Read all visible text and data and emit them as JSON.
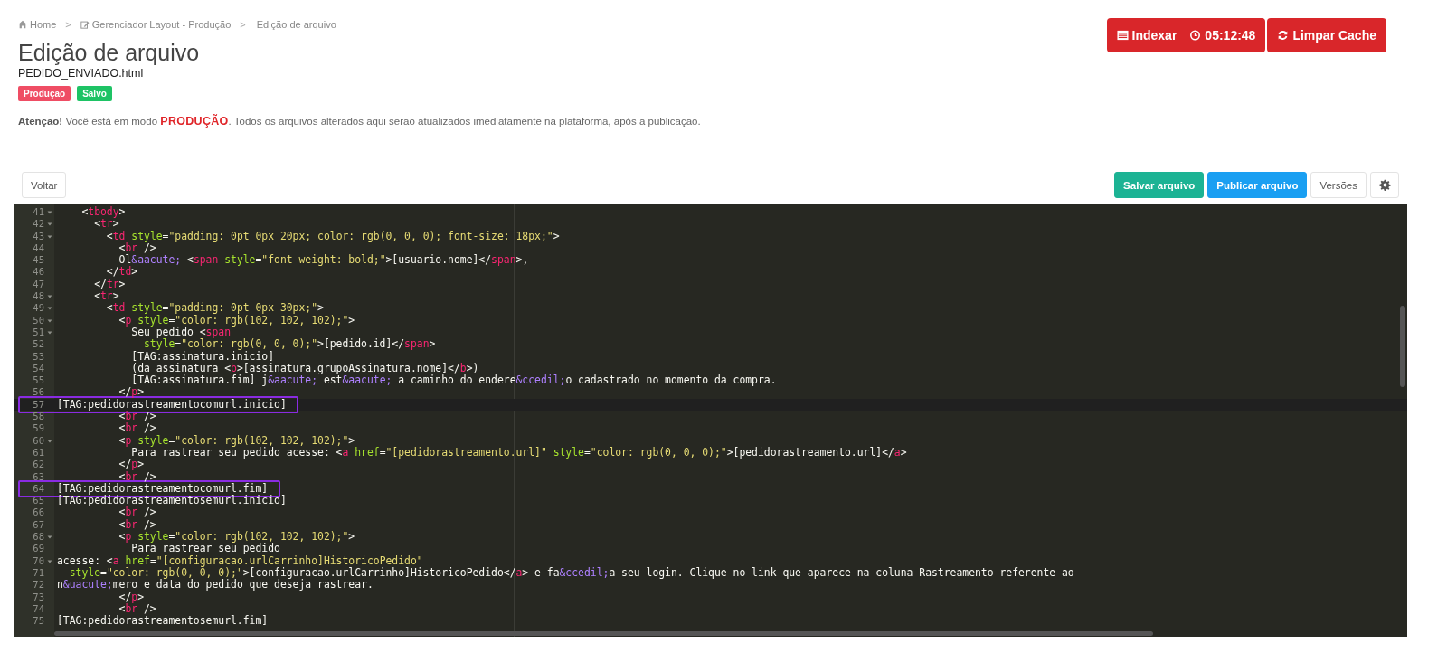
{
  "breadcrumb": [
    {
      "kind": "home",
      "label": "Home"
    },
    {
      "kind": "edit",
      "separator": ">",
      "label": "Gerenciador Layout - Produção"
    },
    {
      "kind": "text",
      "separator": ">",
      "label": "Edição de arquivo"
    }
  ],
  "title": "Edição de arquivo",
  "filename": "PEDIDO_ENVIADO.html",
  "badges": [
    {
      "label": "Produção",
      "color": "#ef4d64"
    },
    {
      "label": "Salvo",
      "color": "#1ec365"
    }
  ],
  "notice": "**Atenção!** Você está em modo **PRODUÇÃO**. Todos os arquivos alterados aqui serão atualizados imediatamente na plataforma, após a publicação.",
  "header_actions": {
    "index_label": "Indexar",
    "timer": "05:12:48",
    "cache_label": "Limpar Cache"
  },
  "back_button": "Voltar",
  "toolbar": [
    {
      "kind": "green",
      "label": "Salvar arquivo"
    },
    {
      "kind": "blue",
      "label": "Publicar arquivo"
    },
    {
      "kind": "plain",
      "label": "Versões"
    },
    {
      "kind": "settings"
    }
  ],
  "editor": {
    "lines": [
      {
        "number": "41",
        "foldable": true,
        "active": false,
        "highlighted": false,
        "tokens": [
          {
            "kind": "punct",
            "text": "    <"
          },
          {
            "kind": "tag",
            "text": "tbody"
          },
          {
            "kind": "punct",
            "text": ">"
          }
        ]
      },
      {
        "number": "42",
        "foldable": true,
        "active": false,
        "highlighted": false,
        "tokens": [
          {
            "kind": "punct",
            "text": "      <"
          },
          {
            "kind": "tag",
            "text": "tr"
          },
          {
            "kind": "punct",
            "text": ">"
          }
        ]
      },
      {
        "number": "43",
        "foldable": true,
        "active": false,
        "highlighted": false,
        "tokens": [
          {
            "kind": "punct",
            "text": "        <"
          },
          {
            "kind": "tag",
            "text": "td"
          },
          {
            "kind": "attr",
            "text": " style"
          },
          {
            "kind": "punct",
            "text": "="
          },
          {
            "kind": "string",
            "text": "\"padding: 0pt 0px 20px; color: rgb(0, 0, 0); font-size: 18px;\""
          },
          {
            "kind": "punct",
            "text": ">"
          }
        ]
      },
      {
        "number": "44",
        "foldable": false,
        "active": false,
        "highlighted": false,
        "tokens": [
          {
            "kind": "punct",
            "text": "          <"
          },
          {
            "kind": "tag",
            "text": "br"
          },
          {
            "kind": "punct",
            "text": " />"
          }
        ]
      },
      {
        "number": "45",
        "foldable": false,
        "active": false,
        "highlighted": false,
        "tokens": [
          {
            "kind": "punct",
            "text": "          Ol"
          },
          {
            "kind": "entity",
            "text": "&aacute;"
          },
          {
            "kind": "punct",
            "text": " <"
          },
          {
            "kind": "tag",
            "text": "span"
          },
          {
            "kind": "attr",
            "text": " style"
          },
          {
            "kind": "punct",
            "text": "="
          },
          {
            "kind": "string",
            "text": "\"font-weight: bold;\""
          },
          {
            "kind": "punct",
            "text": ">[usuario.nome]</"
          },
          {
            "kind": "tag",
            "text": "span"
          },
          {
            "kind": "punct",
            "text": ">,"
          }
        ]
      },
      {
        "number": "46",
        "foldable": false,
        "active": false,
        "highlighted": false,
        "tokens": [
          {
            "kind": "punct",
            "text": "        </"
          },
          {
            "kind": "tag",
            "text": "td"
          },
          {
            "kind": "punct",
            "text": ">"
          }
        ]
      },
      {
        "number": "47",
        "foldable": false,
        "active": false,
        "highlighted": false,
        "tokens": [
          {
            "kind": "punct",
            "text": "      </"
          },
          {
            "kind": "tag",
            "text": "tr"
          },
          {
            "kind": "punct",
            "text": ">"
          }
        ]
      },
      {
        "number": "48",
        "foldable": true,
        "active": false,
        "highlighted": false,
        "tokens": [
          {
            "kind": "punct",
            "text": "      <"
          },
          {
            "kind": "tag",
            "text": "tr"
          },
          {
            "kind": "punct",
            "text": ">"
          }
        ]
      },
      {
        "number": "49",
        "foldable": true,
        "active": false,
        "highlighted": false,
        "tokens": [
          {
            "kind": "punct",
            "text": "        <"
          },
          {
            "kind": "tag",
            "text": "td"
          },
          {
            "kind": "attr",
            "text": " style"
          },
          {
            "kind": "punct",
            "text": "="
          },
          {
            "kind": "string",
            "text": "\"padding: 0pt 0px 30px;\""
          },
          {
            "kind": "punct",
            "text": ">"
          }
        ]
      },
      {
        "number": "50",
        "foldable": true,
        "active": false,
        "highlighted": false,
        "tokens": [
          {
            "kind": "punct",
            "text": "          <"
          },
          {
            "kind": "tag",
            "text": "p"
          },
          {
            "kind": "attr",
            "text": " style"
          },
          {
            "kind": "punct",
            "text": "="
          },
          {
            "kind": "string",
            "text": "\"color: rgb(102, 102, 102);\""
          },
          {
            "kind": "punct",
            "text": ">"
          }
        ]
      },
      {
        "number": "51",
        "foldable": true,
        "active": false,
        "highlighted": false,
        "tokens": [
          {
            "kind": "punct",
            "text": "            Seu pedido <"
          },
          {
            "kind": "tag",
            "text": "span"
          }
        ]
      },
      {
        "number": "52",
        "foldable": false,
        "active": false,
        "highlighted": false,
        "tokens": [
          {
            "kind": "attr",
            "text": "              style"
          },
          {
            "kind": "punct",
            "text": "="
          },
          {
            "kind": "string",
            "text": "\"color: rgb(0, 0, 0);\""
          },
          {
            "kind": "punct",
            "text": ">[pedido.id]</"
          },
          {
            "kind": "tag",
            "text": "span"
          },
          {
            "kind": "punct",
            "text": ">"
          }
        ]
      },
      {
        "number": "53",
        "foldable": false,
        "active": false,
        "highlighted": false,
        "tokens": [
          {
            "kind": "punct",
            "text": "            [TAG:assinatura.inicio]"
          }
        ]
      },
      {
        "number": "54",
        "foldable": false,
        "active": false,
        "highlighted": false,
        "tokens": [
          {
            "kind": "punct",
            "text": "            (da assinatura <"
          },
          {
            "kind": "tag",
            "text": "b"
          },
          {
            "kind": "punct",
            "text": ">[assinatura.grupoAssinatura.nome]</"
          },
          {
            "kind": "tag",
            "text": "b"
          },
          {
            "kind": "punct",
            "text": ">)"
          }
        ]
      },
      {
        "number": "55",
        "foldable": false,
        "active": false,
        "highlighted": false,
        "tokens": [
          {
            "kind": "punct",
            "text": "            [TAG:assinatura.fim] j"
          },
          {
            "kind": "entity",
            "text": "&aacute;"
          },
          {
            "kind": "punct",
            "text": " est"
          },
          {
            "kind": "entity",
            "text": "&aacute;"
          },
          {
            "kind": "punct",
            "text": " a caminho do endere"
          },
          {
            "kind": "entity",
            "text": "&ccedil;"
          },
          {
            "kind": "punct",
            "text": "o cadastrado no momento da compra."
          }
        ]
      },
      {
        "number": "56",
        "foldable": false,
        "active": false,
        "highlighted": false,
        "tokens": [
          {
            "kind": "punct",
            "text": "          </"
          },
          {
            "kind": "tag",
            "text": "p"
          },
          {
            "kind": "punct",
            "text": ">"
          }
        ]
      },
      {
        "number": "57",
        "foldable": false,
        "active": true,
        "highlighted": true,
        "tokens": [
          {
            "kind": "punct",
            "text": "[TAG:pedidorastreamentocomurl.inicio]"
          }
        ]
      },
      {
        "number": "58",
        "foldable": false,
        "active": false,
        "highlighted": false,
        "tokens": [
          {
            "kind": "punct",
            "text": "          <"
          },
          {
            "kind": "tag",
            "text": "br"
          },
          {
            "kind": "punct",
            "text": " />"
          }
        ]
      },
      {
        "number": "59",
        "foldable": false,
        "active": false,
        "highlighted": false,
        "tokens": [
          {
            "kind": "punct",
            "text": "          <"
          },
          {
            "kind": "tag",
            "text": "br"
          },
          {
            "kind": "punct",
            "text": " />"
          }
        ]
      },
      {
        "number": "60",
        "foldable": true,
        "active": false,
        "highlighted": false,
        "tokens": [
          {
            "kind": "punct",
            "text": "          <"
          },
          {
            "kind": "tag",
            "text": "p"
          },
          {
            "kind": "attr",
            "text": " style"
          },
          {
            "kind": "punct",
            "text": "="
          },
          {
            "kind": "string",
            "text": "\"color: rgb(102, 102, 102);\""
          },
          {
            "kind": "punct",
            "text": ">"
          }
        ]
      },
      {
        "number": "61",
        "foldable": false,
        "active": false,
        "highlighted": false,
        "tokens": [
          {
            "kind": "punct",
            "text": "            Para rastrear seu pedido acesse: <"
          },
          {
            "kind": "tag",
            "text": "a"
          },
          {
            "kind": "attr",
            "text": " href"
          },
          {
            "kind": "punct",
            "text": "="
          },
          {
            "kind": "string",
            "text": "\"[pedidorastreamento.url]\""
          },
          {
            "kind": "attr",
            "text": " style"
          },
          {
            "kind": "punct",
            "text": "="
          },
          {
            "kind": "string",
            "text": "\"color: rgb(0, 0, 0);\""
          },
          {
            "kind": "punct",
            "text": ">[pedidorastreamento.url]</"
          },
          {
            "kind": "tag",
            "text": "a"
          },
          {
            "kind": "punct",
            "text": ">"
          }
        ]
      },
      {
        "number": "62",
        "foldable": false,
        "active": false,
        "highlighted": false,
        "tokens": [
          {
            "kind": "punct",
            "text": "          </"
          },
          {
            "kind": "tag",
            "text": "p"
          },
          {
            "kind": "punct",
            "text": ">"
          }
        ]
      },
      {
        "number": "63",
        "foldable": false,
        "active": false,
        "highlighted": false,
        "tokens": [
          {
            "kind": "punct",
            "text": "          <"
          },
          {
            "kind": "tag",
            "text": "br"
          },
          {
            "kind": "punct",
            "text": " />"
          }
        ]
      },
      {
        "number": "64",
        "foldable": false,
        "active": false,
        "highlighted": true,
        "tokens": [
          {
            "kind": "punct",
            "text": "[TAG:pedidorastreamentocomurl.fim]"
          }
        ]
      },
      {
        "number": "65",
        "foldable": false,
        "active": false,
        "highlighted": false,
        "tokens": [
          {
            "kind": "punct",
            "text": "[TAG:pedidorastreamentosemurl.inicio]"
          }
        ]
      },
      {
        "number": "66",
        "foldable": false,
        "active": false,
        "highlighted": false,
        "tokens": [
          {
            "kind": "punct",
            "text": "          <"
          },
          {
            "kind": "tag",
            "text": "br"
          },
          {
            "kind": "punct",
            "text": " />"
          }
        ]
      },
      {
        "number": "67",
        "foldable": false,
        "active": false,
        "highlighted": false,
        "tokens": [
          {
            "kind": "punct",
            "text": "          <"
          },
          {
            "kind": "tag",
            "text": "br"
          },
          {
            "kind": "punct",
            "text": " />"
          }
        ]
      },
      {
        "number": "68",
        "foldable": true,
        "active": false,
        "highlighted": false,
        "tokens": [
          {
            "kind": "punct",
            "text": "          <"
          },
          {
            "kind": "tag",
            "text": "p"
          },
          {
            "kind": "attr",
            "text": " style"
          },
          {
            "kind": "punct",
            "text": "="
          },
          {
            "kind": "string",
            "text": "\"color: rgb(102, 102, 102);\""
          },
          {
            "kind": "punct",
            "text": ">"
          }
        ]
      },
      {
        "number": "69",
        "foldable": false,
        "active": false,
        "highlighted": false,
        "tokens": [
          {
            "kind": "punct",
            "text": "            Para rastrear seu pedido"
          }
        ]
      },
      {
        "number": "70",
        "foldable": true,
        "active": false,
        "highlighted": false,
        "tokens": [
          {
            "kind": "punct",
            "text": "acesse: <"
          },
          {
            "kind": "tag",
            "text": "a"
          },
          {
            "kind": "attr",
            "text": " href"
          },
          {
            "kind": "punct",
            "text": "="
          },
          {
            "kind": "string",
            "text": "\"[configuracao.urlCarrinho]HistoricoPedido\""
          }
        ]
      },
      {
        "number": "71",
        "foldable": false,
        "active": false,
        "highlighted": false,
        "tokens": [
          {
            "kind": "attr",
            "text": "  style"
          },
          {
            "kind": "punct",
            "text": "="
          },
          {
            "kind": "string",
            "text": "\"color: rgb(0, 0, 0);\""
          },
          {
            "kind": "punct",
            "text": ">[configuracao.urlCarrinho]HistoricoPedido</"
          },
          {
            "kind": "tag",
            "text": "a"
          },
          {
            "kind": "punct",
            "text": "> e fa"
          },
          {
            "kind": "entity",
            "text": "&ccedil;"
          },
          {
            "kind": "punct",
            "text": "a seu login. Clique no link que aparece na coluna Rastreamento referente ao"
          }
        ]
      },
      {
        "number": "72",
        "foldable": false,
        "active": false,
        "highlighted": false,
        "tokens": [
          {
            "kind": "punct",
            "text": "n"
          },
          {
            "kind": "entity",
            "text": "&uacute;"
          },
          {
            "kind": "punct",
            "text": "mero e data do pedido que deseja rastrear."
          }
        ]
      },
      {
        "number": "73",
        "foldable": false,
        "active": false,
        "highlighted": false,
        "tokens": [
          {
            "kind": "punct",
            "text": "          </"
          },
          {
            "kind": "tag",
            "text": "p"
          },
          {
            "kind": "punct",
            "text": ">"
          }
        ]
      },
      {
        "number": "74",
        "foldable": false,
        "active": false,
        "highlighted": false,
        "tokens": [
          {
            "kind": "punct",
            "text": "          <"
          },
          {
            "kind": "tag",
            "text": "br"
          },
          {
            "kind": "punct",
            "text": " />"
          }
        ]
      },
      {
        "number": "75",
        "foldable": false,
        "active": false,
        "highlighted": false,
        "tokens": [
          {
            "kind": "punct",
            "text": "[TAG:pedidorastreamentosemurl.fim]"
          }
        ]
      }
    ]
  }
}
